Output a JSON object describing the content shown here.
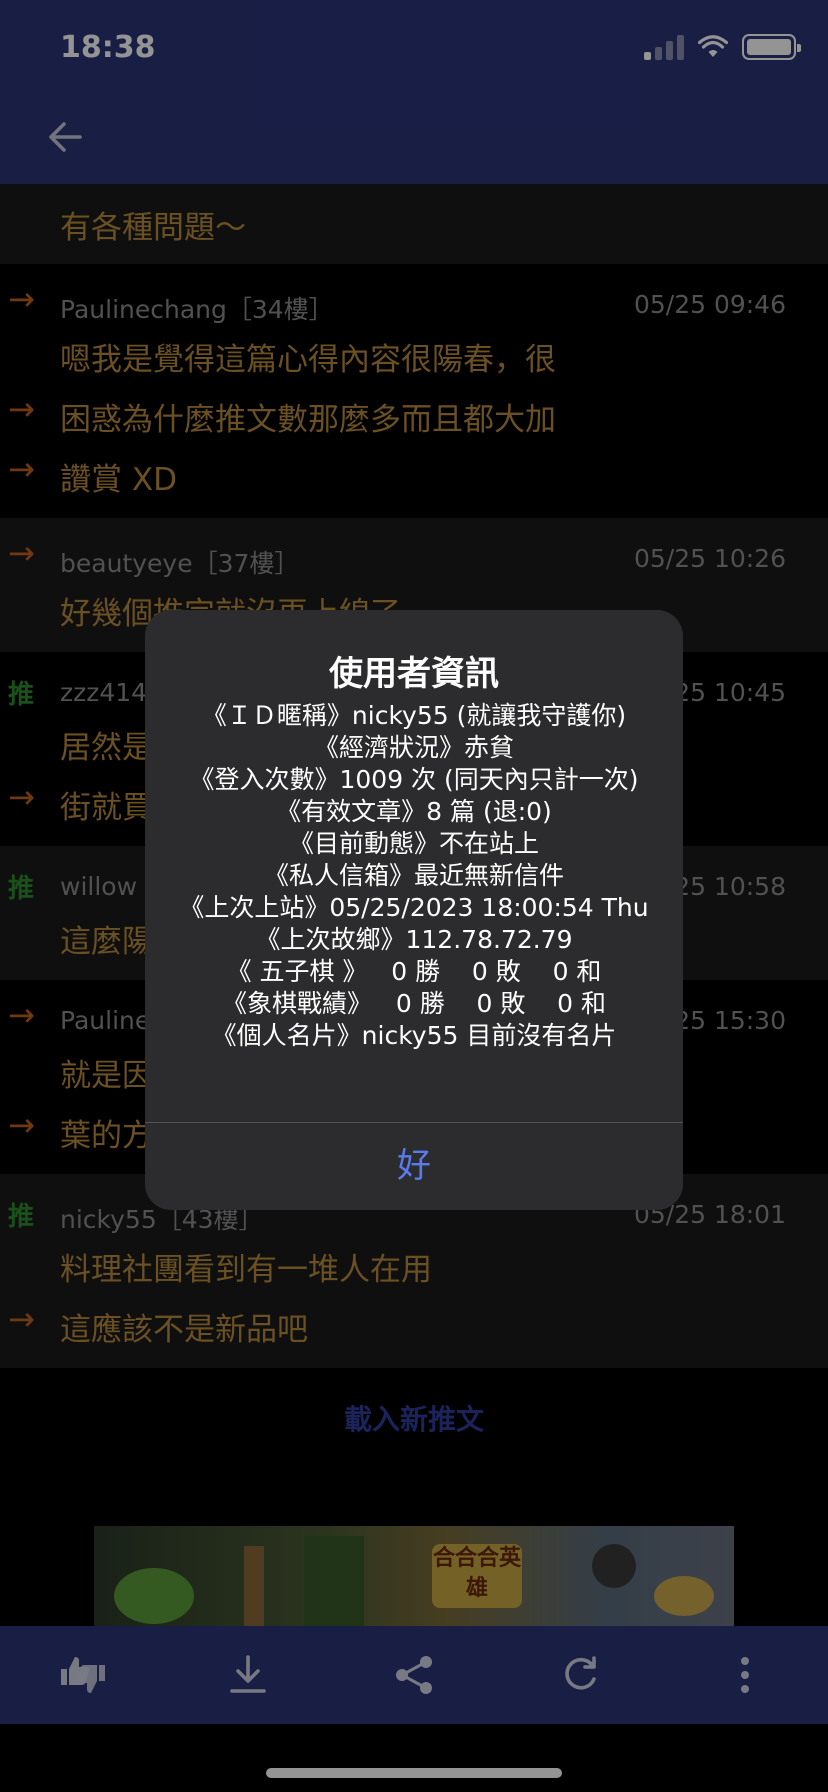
{
  "status_bar": {
    "time": "18:38"
  },
  "comments": [
    {
      "lines": [
        "有各種問題～"
      ]
    },
    {
      "tag": "→",
      "user": "Paulinechang［34樓］",
      "date": "05/25 09:46",
      "lines": [
        "嗯我是覺得這篇心得內容很陽春，很",
        "困惑為什麼推文數那麼多而且都大加",
        "讚賞 XD"
      ]
    },
    {
      "tag": "→",
      "user": "beautyeye［37樓］",
      "date": "05/25 10:26",
      "lines": [
        "好幾個推完就沒再上線了"
      ]
    },
    {
      "tag": "推",
      "user": "zzz414",
      "date": "05/25 10:45",
      "lines": [
        "居然是",
        "街就買"
      ]
    },
    {
      "tag": "推",
      "user": "willow",
      "date": "05/25 10:58",
      "lines": [
        "這麼陽"
      ]
    },
    {
      "tag": "→",
      "user": "Pauline",
      "date": "05/25 15:30",
      "lines": [
        "就是因",
        "葉的方"
      ]
    },
    {
      "tag": "推",
      "user": "nicky55［43樓］",
      "date": "05/25 18:01",
      "lines": [
        "料理社團看到有一堆人在用",
        "這應該不是新品吧"
      ]
    }
  ],
  "load_more_label": "載入新推文",
  "banner": {
    "logo_text": "合合合英雄"
  },
  "dialog": {
    "title": "使用者資訊",
    "lines": [
      "《ＩＤ暱稱》nicky55 (就讓我守護你)",
      "《經濟狀況》赤貧",
      "《登入次數》1009 次 (同天內只計一次)",
      "《有效文章》8 篇 (退:0)",
      "《目前動態》不在站上",
      "《私人信箱》最近無新信件",
      "《上次上站》05/25/2023 18:00:54 Thu",
      "《上次故鄉》112.78.72.79",
      "《 五子棋 》   0 勝    0 敗    0 和",
      "《象棋戰績》   0 勝    0 敗    0 和",
      "《個人名片》nicky55 目前沒有名片"
    ],
    "ok_label": "好"
  },
  "colors": {
    "nav_bg": "#2b3478",
    "comment_text": "#b98a3c",
    "arrow_tag": "#c2621f",
    "push_tag": "#2e8a2e",
    "dialog_button": "#5a7bf0"
  },
  "toolbar_icons": [
    "thumbs-up-down-icon",
    "download-icon",
    "share-icon",
    "refresh-icon",
    "more-vertical-icon"
  ]
}
